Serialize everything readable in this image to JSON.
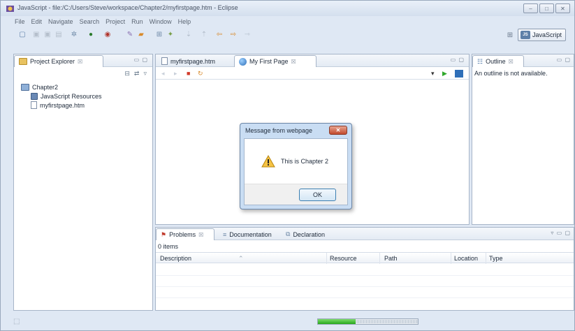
{
  "window": {
    "title": "JavaScript - file:/C:/Users/Steve/workspace/Chapter2/myfirstpage.htm - Eclipse",
    "controls": {
      "minimize": "–",
      "maximize": "□",
      "close": "✕"
    }
  },
  "menu": [
    "File",
    "Edit",
    "Navigate",
    "Search",
    "Project",
    "Run",
    "Window",
    "Help"
  ],
  "perspective": {
    "label": "JavaScript",
    "open_icon": "open-perspective-icon"
  },
  "project_explorer": {
    "tab_label": "Project Explorer",
    "tab_close": "☒",
    "tree": {
      "project": "Chapter2",
      "children": [
        "JavaScript Resources",
        "myfirstpage.htm"
      ]
    }
  },
  "editor": {
    "tabs": [
      {
        "label": "myfirstpage.htm",
        "icon": "page-icon"
      },
      {
        "label": "My First Page",
        "icon": "globe-icon"
      }
    ],
    "tab_close": "☒"
  },
  "outline": {
    "tab_label": "Outline",
    "tab_close": "☒",
    "message": "An outline is not available."
  },
  "problems_panel": {
    "tabs": [
      {
        "label": "Problems",
        "icon": "problems-icon"
      },
      {
        "label": "Documentation",
        "icon": "documentation-icon"
      },
      {
        "label": "Declaration",
        "icon": "declaration-icon"
      }
    ],
    "tab_close": "☒",
    "items_count": "0 items",
    "columns": [
      "Description",
      "Resource",
      "Path",
      "Location",
      "Type"
    ]
  },
  "dialog": {
    "title": "Message from webpage",
    "close": "✕",
    "message": "This is Chapter 2",
    "ok_label": "OK"
  },
  "status": {
    "progress": 0.38
  },
  "colors": {
    "accent": "#3c7fb1",
    "progress": "#27a81a",
    "chrome": "#dfe8f4"
  }
}
